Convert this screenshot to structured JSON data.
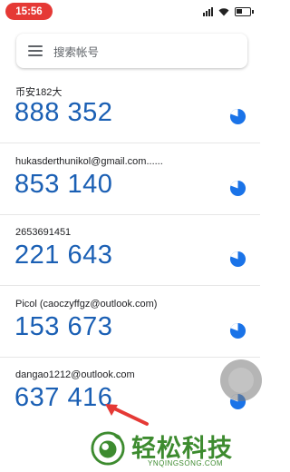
{
  "status_bar": {
    "time": "15:56",
    "icons": [
      "signal-icon",
      "wifi-icon",
      "battery-icon"
    ]
  },
  "search": {
    "placeholder": "搜索帐号",
    "menu_icon": "menu-icon"
  },
  "accounts": [
    {
      "label": "币安182大",
      "code": "888 352"
    },
    {
      "label": "hukasderthunikol@gmail.com......",
      "code": "853 140"
    },
    {
      "label": "2653691451",
      "code": "221 643"
    },
    {
      "label": "Picol (caoczyffgz@outlook.com)",
      "code": "153 673"
    },
    {
      "label": "dangao1212@outlook.com",
      "code": "637 416"
    }
  ],
  "watermark": {
    "title": "轻松科技",
    "subtitle": "YNQINGSONG.COM"
  },
  "colors": {
    "code": "#1a5fb4",
    "timer": "#1a73e8",
    "time_pill": "#e53935",
    "watermark": "#3d8b2f",
    "arrow": "#e53935"
  }
}
